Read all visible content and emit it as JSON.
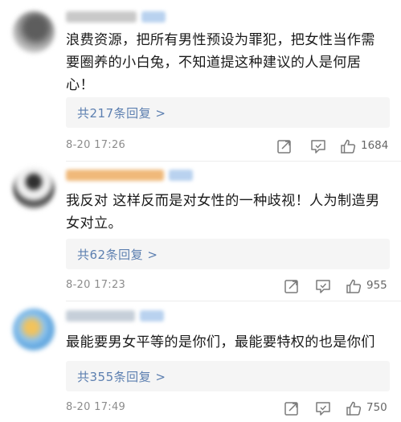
{
  "comments": [
    {
      "text": "浪费资源，把所有男性预设为罪犯，把女性当作需要圈养的小白兔，不知道提这种建议的人是何居心！",
      "reply_label": "共217条回复 >",
      "time": "8-20 17:26",
      "likes": "1684"
    },
    {
      "text": "我反对 这样反而是对女性的一种歧视！人为制造男女对立。",
      "reply_label": "共62条回复 >",
      "time": "8-20 17:23",
      "likes": "955"
    },
    {
      "text": "最能要男女平等的是你们，最能要特权的也是你们",
      "reply_label": "共355条回复 >",
      "time": "8-20 17:49",
      "likes": "750"
    }
  ],
  "icons": {
    "share": "share-icon",
    "comment": "comment-icon",
    "like": "thumbs-up-icon"
  },
  "colors": {
    "reply_link": "#5c7fb0",
    "text": "#1a1a1a",
    "meta": "#8c8c8c"
  }
}
